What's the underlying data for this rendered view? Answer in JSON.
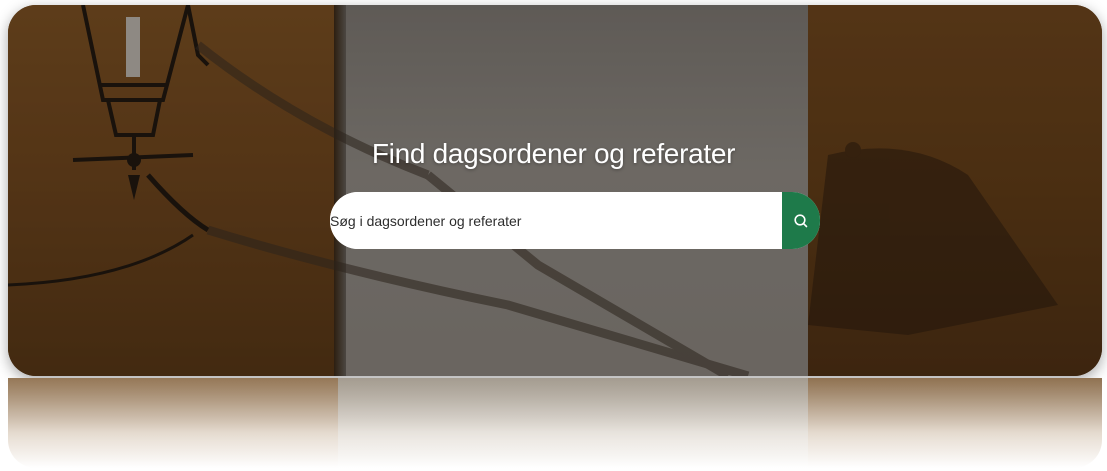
{
  "hero": {
    "title": "Find dagsordener og referater"
  },
  "search": {
    "placeholder": "Søg i dagsordener og referater",
    "value": "",
    "button_icon": "search-icon",
    "accent_color": "#1e7a4a"
  }
}
